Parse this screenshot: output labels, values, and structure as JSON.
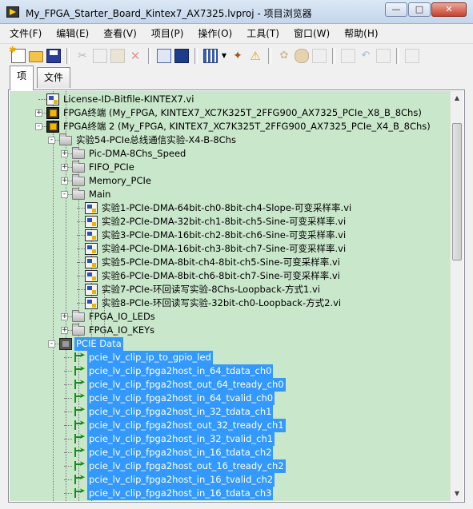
{
  "window": {
    "title": "My_FPGA_Starter_Board_Kintex7_AX7325.lvproj - 项目浏览器",
    "minimize": "—",
    "maximize": "□",
    "close": "✕"
  },
  "menu": [
    "文件(F)",
    "编辑(E)",
    "查看(V)",
    "项目(P)",
    "操作(O)",
    "工具(T)",
    "窗口(W)",
    "帮助(H)"
  ],
  "tabs": [
    "项",
    "文件"
  ],
  "tree": {
    "items": [
      {
        "label": "License-ID-Bitfile-KINTEX7.vi",
        "icon": "vi-icon"
      },
      {
        "label": "FPGA终端 (My_FPGA, KINTEX7_XC7K325T_2FFG900_AX7325_PCIe_X8_B_8Chs)",
        "icon": "fpga-target-icon",
        "expander": "+"
      },
      {
        "label": "FPGA终端 2 (My_FPGA, KINTEX7_XC7K325T_2FFG900_AX7325_PCIe_X4_B_8Chs)",
        "icon": "fpga-target-icon",
        "expander": "-"
      },
      {
        "label": "实验54-PCIe总线通信实验-X4-B-8Chs",
        "icon": "folder-icon",
        "expander": "-"
      },
      {
        "label": "Pic-DMA-8Chs_Speed",
        "icon": "folder-icon",
        "expander": "+"
      },
      {
        "label": "FIFO_PCIe",
        "icon": "folder-icon",
        "expander": "+"
      },
      {
        "label": "Memory_PCIe",
        "icon": "folder-icon",
        "expander": "+"
      },
      {
        "label": "Main",
        "icon": "folder-icon",
        "expander": "-"
      },
      {
        "label": "实验1-PCIe-DMA-64bit-ch0-8bit-ch4-Slope-可变采样率.vi",
        "icon": "vi-icon"
      },
      {
        "label": "实验2-PCIe-DMA-32bit-ch1-8bit-ch5-Sine-可变采样率.vi",
        "icon": "vi-icon"
      },
      {
        "label": "实验3-PCIe-DMA-16bit-ch2-8bit-ch6-Sine-可变采样率.vi",
        "icon": "vi-icon"
      },
      {
        "label": "实验4-PCIe-DMA-16bit-ch3-8bit-ch7-Sine-可变采样率.vi",
        "icon": "vi-icon"
      },
      {
        "label": "实验5-PCIe-DMA-8bit-ch4-8bit-ch5-Sine-可变采样率.vi",
        "icon": "vi-icon"
      },
      {
        "label": "实验6-PCIe-DMA-8bit-ch6-8bit-ch7-Sine-可变采样率.vi",
        "icon": "vi-icon"
      },
      {
        "label": "实验7-PCIe-环回读写实验-8Chs-Loopback-方式1.vi",
        "icon": "vi-icon"
      },
      {
        "label": "实验8-PCIe-环回读写实验-32bit-ch0-Loopback-方式2.vi",
        "icon": "vi-icon"
      },
      {
        "label": "FPGA_IO_LEDs",
        "icon": "folder-icon",
        "expander": "+"
      },
      {
        "label": "FPGA_IO_KEYs",
        "icon": "folder-icon",
        "expander": "+"
      },
      {
        "label": "PCIE Data",
        "icon": "chip-icon",
        "expander": "-",
        "selected": true
      },
      {
        "label": "pcie_lv_clip_ip_to_gpio_led",
        "icon": "clip-io-icon",
        "selected": true
      },
      {
        "label": "pcie_lv_clip_fpga2host_in_64_tdata_ch0",
        "icon": "clip-io-icon",
        "selected": true
      },
      {
        "label": "pcie_lv_clip_fpga2host_out_64_tready_ch0",
        "icon": "clip-io-icon",
        "selected": true
      },
      {
        "label": "pcie_lv_clip_fpga2host_in_64_tvalid_ch0",
        "icon": "clip-io-icon",
        "selected": true
      },
      {
        "label": "pcie_lv_clip_fpga2host_in_32_tdata_ch1",
        "icon": "clip-io-icon",
        "selected": true
      },
      {
        "label": "pcie_lv_clip_fpga2host_out_32_tready_ch1",
        "icon": "clip-io-icon",
        "selected": true
      },
      {
        "label": "pcie_lv_clip_fpga2host_in_32_tvalid_ch1",
        "icon": "clip-io-icon",
        "selected": true
      },
      {
        "label": "pcie_lv_clip_fpga2host_in_16_tdata_ch2",
        "icon": "clip-io-icon",
        "selected": true
      },
      {
        "label": "pcie_lv_clip_fpga2host_out_16_tready_ch2",
        "icon": "clip-io-icon",
        "selected": true
      },
      {
        "label": "pcie_lv_clip_fpga2host_in_16_tvalid_ch2",
        "icon": "clip-io-icon",
        "selected": true
      },
      {
        "label": "pcie_lv_clip_fpga2host_in_16_tdata_ch3",
        "icon": "clip-io-icon",
        "selected": true
      }
    ]
  },
  "colors": {
    "tree_bg": "#c9e7cb",
    "selection": "#3399ff"
  }
}
